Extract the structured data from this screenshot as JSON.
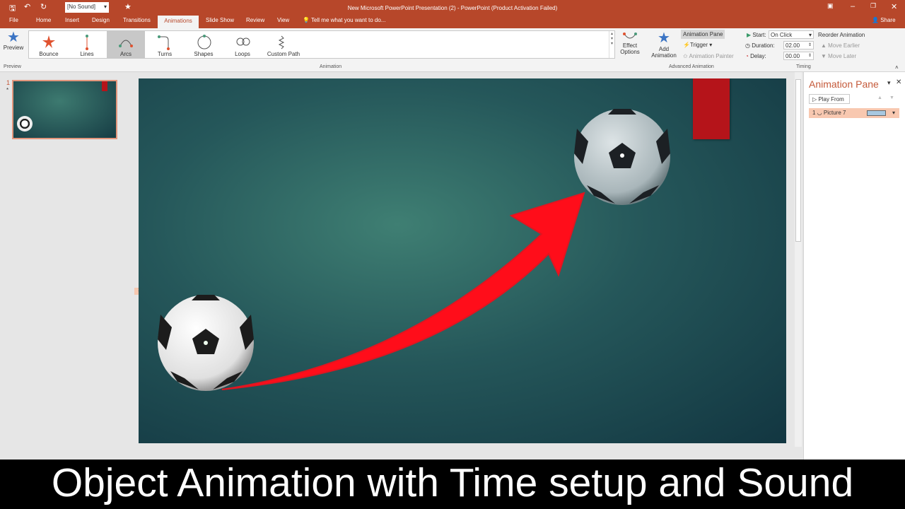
{
  "window": {
    "title": "New Microsoft PowerPoint Presentation (2) - PowerPoint (Product Activation Failed)",
    "sound_value": "[No Sound]",
    "share": "Share"
  },
  "tabs": [
    "File",
    "Home",
    "Insert",
    "Design",
    "Transitions",
    "Animations",
    "Slide Show",
    "Review",
    "View"
  ],
  "active_tab": "Animations",
  "tell_me": "Tell me what you want to do...",
  "ribbon": {
    "preview": {
      "label": "Preview",
      "group": "Preview"
    },
    "gallery": [
      "Bounce",
      "Lines",
      "Arcs",
      "Turns",
      "Shapes",
      "Loops",
      "Custom Path"
    ],
    "selected_effect": "Arcs",
    "animation_group": "Animation",
    "effect_options": [
      "Effect",
      "Options"
    ],
    "add_animation": [
      "Add",
      "Animation"
    ],
    "animation_pane": "Animation Pane",
    "trigger": "Trigger",
    "animation_painter": "Animation Painter",
    "advanced_group": "Advanced Animation",
    "start_label": "Start:",
    "start_value": "On Click",
    "duration_label": "Duration:",
    "duration_value": "02.00",
    "delay_label": "Delay:",
    "delay_value": "00.00",
    "reorder": "Reorder Animation",
    "move_earlier": "Move Earlier",
    "move_later": "Move Later",
    "timing_group": "Timing"
  },
  "thumbnails": {
    "number": "1",
    "star": "*"
  },
  "slide": {
    "anim_marker": "1",
    "accent": "#ff0d1a",
    "bar_color": "#b5141a"
  },
  "animation_pane": {
    "title": "Animation Pane",
    "play_from": "Play From",
    "items": [
      {
        "index": "1",
        "name": "Picture 7"
      }
    ]
  },
  "banner": "Object Animation with Time setup and Sound"
}
